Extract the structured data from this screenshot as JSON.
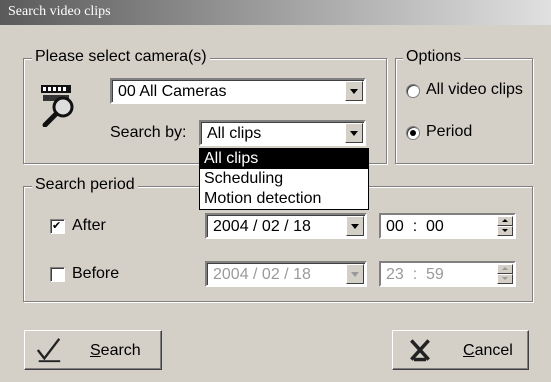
{
  "window": {
    "title": "Search video clips"
  },
  "camera_group": {
    "legend": "Please select camera(s)",
    "camera_value": "00 All Cameras",
    "search_by_label": "Search by:",
    "search_by_value": "All clips",
    "dropdown_options": [
      "All clips",
      "Scheduling",
      "Motion detection"
    ],
    "selected_option_index": 0
  },
  "options_group": {
    "legend": "Options",
    "radio_all": {
      "label": "All video clips",
      "selected": false
    },
    "radio_period": {
      "label": "Period",
      "selected": true
    }
  },
  "period_group": {
    "legend": "Search period",
    "after": {
      "label": "After",
      "checked": true,
      "date": "2004 / 02 / 18",
      "time": "00  :  00"
    },
    "before": {
      "label": "Before",
      "checked": false,
      "date": "2004 / 02 / 18",
      "time": "23  :  59"
    }
  },
  "buttons": {
    "search": {
      "label": "Search",
      "accel": "S"
    },
    "cancel": {
      "label": "Cancel",
      "accel": "C"
    }
  }
}
